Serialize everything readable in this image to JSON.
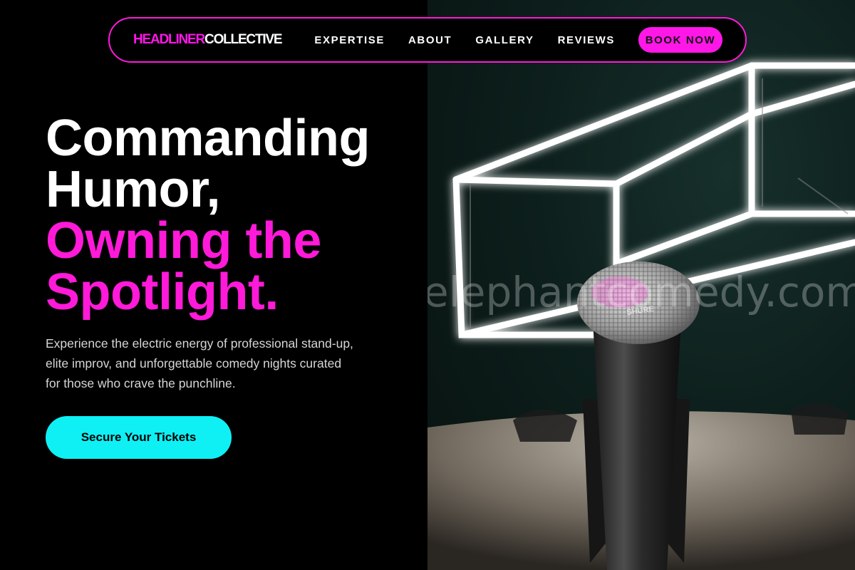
{
  "nav": {
    "brand_part1": "HEADLINER",
    "brand_part2": "COLLECTIVE",
    "links": [
      "EXPERTISE",
      "ABOUT",
      "GALLERY",
      "REVIEWS"
    ],
    "book_label": "BOOK NOW"
  },
  "hero": {
    "title_line1": "Commanding",
    "title_line2": "Humor,",
    "title_line3": "Owning the",
    "title_line4": "Spotlight.",
    "description": "Experience the electric energy of professional stand-up, elite improv, and unforgettable comedy nights curated for those who crave the punchline.",
    "cta_label": "Secure Your Tickets"
  },
  "image": {
    "watermark": "elephantcomedy.com",
    "mic_label": "SHURE"
  },
  "colors": {
    "accent_pink": "#ff1ad9",
    "accent_cyan": "#0ff0f5",
    "background": "#000000"
  }
}
